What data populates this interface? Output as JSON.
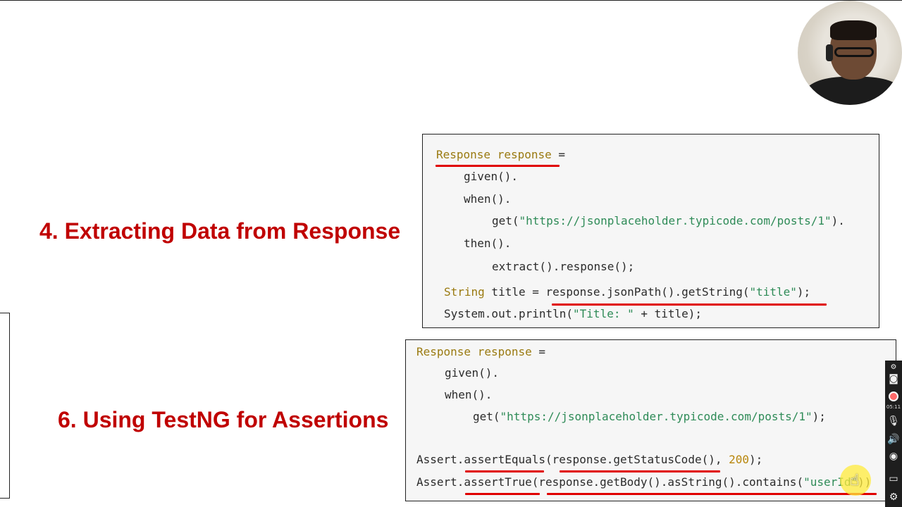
{
  "slide": {
    "heading_top": "4. Extracting Data from Response",
    "heading_bottom": "6. Using TestNG for Assertions"
  },
  "code_top": {
    "l1_type": "Response response",
    "l1_rest": " =",
    "l2": "given().",
    "l3": "when().",
    "l4_pre": "get(",
    "l4_str": "\"https://jsonplaceholder.typicode.com/posts/1\"",
    "l4_post": ").",
    "l5": "then().",
    "l6": "extract().response();",
    "l7_type": "String",
    "l7_mid": " title = response.jsonPath().getString(",
    "l7_str": "\"title\"",
    "l7_post": ");",
    "l8_pre": "System.out.println(",
    "l8_str": "\"Title: \"",
    "l8_post": " + title);"
  },
  "code_bottom": {
    "l1_type": "Response response",
    "l1_rest": " =",
    "l2": "given().",
    "l3": "when().",
    "l4_pre": "get(",
    "l4_str": "\"https://jsonplaceholder.typicode.com/posts/1\"",
    "l4_post": ");",
    "l5_pre": "Assert.assertEquals(response.getStatusCode(), ",
    "l5_num": "200",
    "l5_post": ");",
    "l6_pre": "Assert.assertTrue(response.getBody().asString().contains(",
    "l6_str": "\"userId\"",
    "l6_post": "))"
  },
  "recorder_toolbar": {
    "elapsed_time": "05:11",
    "icons": [
      "settings-icon",
      "camera-icon",
      "record-icon",
      "microphone-icon",
      "speaker-icon",
      "webcam-icon",
      "screen-icon",
      "gear-icon"
    ]
  },
  "colors": {
    "heading": "#c00000",
    "underline": "#e00000",
    "code_type": "#9a7a10",
    "code_string": "#2e8b57",
    "code_number": "#b8860b",
    "code_background": "#f6f6f6"
  }
}
